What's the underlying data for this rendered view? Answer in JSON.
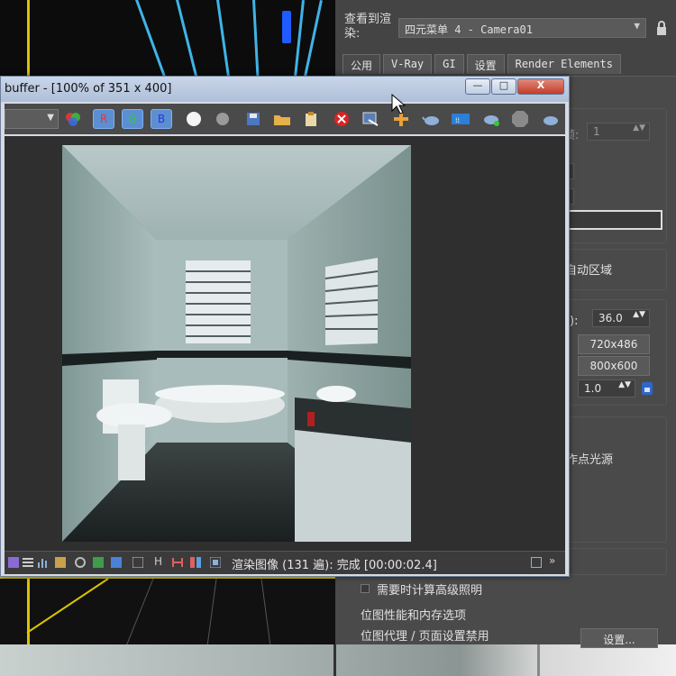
{
  "frame_buffer": {
    "title": "buffer - [100% of 351 x 400]",
    "window_buttons": {
      "minimize": "—",
      "maximize": "□",
      "close": "X"
    },
    "channel_buttons": {
      "red": "R",
      "green": "G",
      "blue": "B"
    },
    "status": "渲染图像 (131 遍): 完成 [00:00:02.4]",
    "status_letter": "H"
  },
  "render_setup": {
    "view_label": "查看到渲染:",
    "camera_value": "四元菜单 4 - Camera01",
    "tabs": [
      "公用",
      "V-Ray",
      "GI",
      "设置",
      "Render Elements"
    ],
    "frame_label": "帧:",
    "frame_value": "1",
    "auto_region": "自动区域",
    "aperture_label": "米):",
    "aperture_value": "36.0",
    "preset_1": "720x486",
    "preset_2": "800x600",
    "aspect_value": "1.0",
    "point_light": "视作点光源",
    "advanced_lighting": "需要时计算高级照明",
    "bitmap_perf": "位图性能和内存选项",
    "bitmap_proxy": "位图代理 / 页面设置禁用",
    "setup_button": "设置..."
  },
  "colors": {
    "panel_bg": "#444444",
    "vfb_title_bg": "#b9c8de",
    "viewport_accent": "#d9c400",
    "grid_line": "#3fb4e6"
  }
}
